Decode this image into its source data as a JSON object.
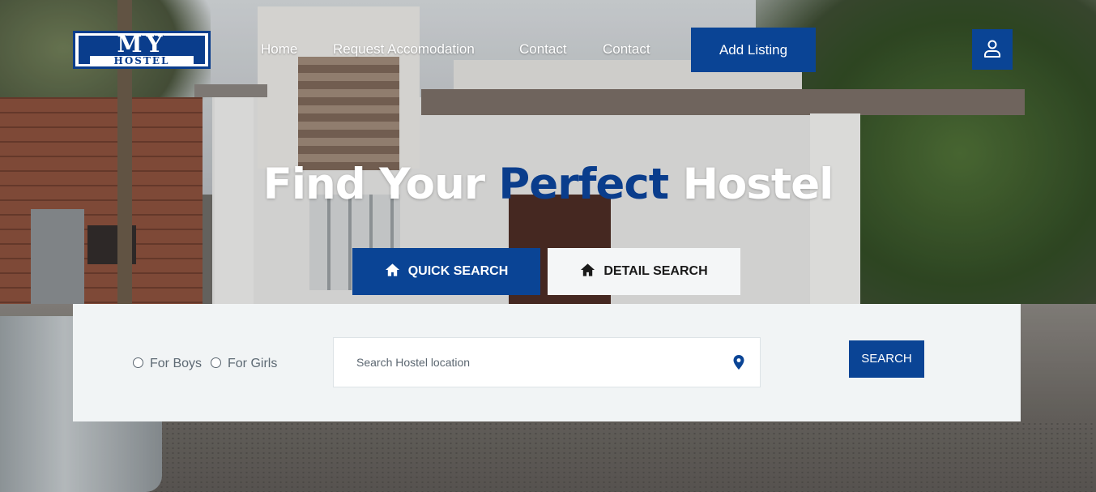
{
  "brand": {
    "logo_top": "MY",
    "logo_bottom": "HOSTEL",
    "color": "#0a3d8c"
  },
  "nav": {
    "items": [
      {
        "label": "Home"
      },
      {
        "label": "Request Accomodation"
      },
      {
        "label": "Contact"
      },
      {
        "label": "Contact"
      }
    ],
    "add_listing_label": "Add Listing",
    "user_icon": "user-icon"
  },
  "hero": {
    "title_part1": "Find Your",
    "title_accent": "Perfect",
    "title_part2": "Hostel"
  },
  "search_tabs": [
    {
      "label": "QUICK SEARCH",
      "icon": "home-icon",
      "active": true
    },
    {
      "label": "DETAIL SEARCH",
      "icon": "home-icon",
      "active": false
    }
  ],
  "search": {
    "options": [
      {
        "label": "For Boys",
        "checked": false
      },
      {
        "label": "For Girls",
        "checked": false
      }
    ],
    "location_placeholder": "Search Hostel location",
    "location_icon": "map-pin-icon",
    "button_label": "SEARCH"
  },
  "colors": {
    "accent": "#0a4495",
    "panel": "#f1f4f5"
  }
}
